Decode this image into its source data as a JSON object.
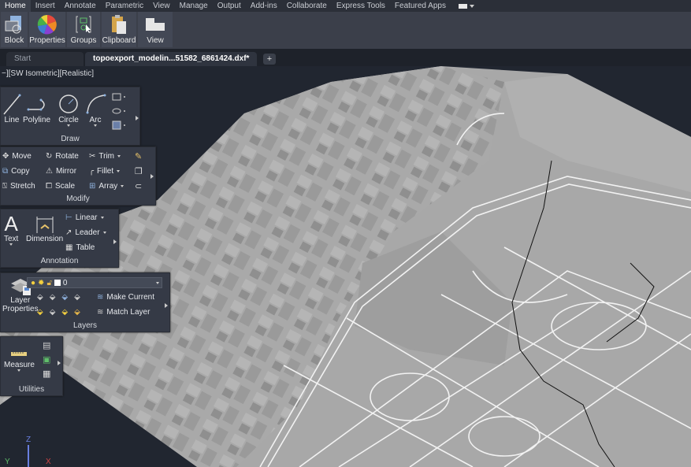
{
  "menubar": {
    "tabs": [
      "Home",
      "Insert",
      "Annotate",
      "Parametric",
      "View",
      "Manage",
      "Output",
      "Add-ins",
      "Collaborate",
      "Express Tools",
      "Featured Apps"
    ],
    "active_tab": "Home"
  },
  "ribbon": {
    "buttons": [
      "Block",
      "Properties",
      "Groups",
      "Clipboard",
      "View"
    ]
  },
  "file_tabs": {
    "start": "Start",
    "active": "topoexport_modelin...51582_6861424.dxf*",
    "close_glyph": "✕",
    "add_glyph": "+"
  },
  "viewport": {
    "label": "−][SW Isometric][Realistic]"
  },
  "panels": {
    "draw": {
      "title": "Draw",
      "tools": [
        "Line",
        "Polyline",
        "Circle",
        "Arc"
      ]
    },
    "modify": {
      "title": "Modify",
      "tools": [
        "Move",
        "Rotate",
        "Trim",
        "Copy",
        "Mirror",
        "Fillet",
        "Stretch",
        "Scale",
        "Array"
      ]
    },
    "annotation": {
      "title": "Annotation",
      "tools": [
        "Text",
        "Dimension",
        "Linear",
        "Leader",
        "Table"
      ]
    },
    "layers": {
      "title": "Layers",
      "properties_label_1": "Layer",
      "properties_label_2": "Properties",
      "current_layer": "0",
      "make_current": "Make Current",
      "match_layer": "Match Layer"
    },
    "utilities": {
      "title": "Utilities",
      "measure": "Measure"
    }
  },
  "ucs": {
    "x": "X",
    "y": "Y",
    "z": "Z"
  }
}
